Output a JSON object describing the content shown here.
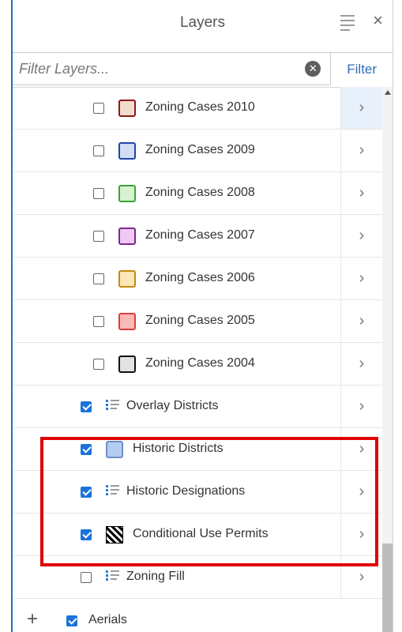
{
  "header": {
    "title": "Layers",
    "close_glyph": "×",
    "menu_icon": "list-menu-icon"
  },
  "filter": {
    "placeholder": "Filter Layers...",
    "value": "",
    "clear_glyph": "✕",
    "button_label": "Filter"
  },
  "layers": [
    {
      "label": "Zoning Cases 2010",
      "checked": false,
      "icon": "swatch",
      "fill": "#f4dccd",
      "stroke": "#8b1a1a",
      "indent": 102,
      "active": true
    },
    {
      "label": "Zoning Cases 2009",
      "checked": false,
      "icon": "swatch",
      "fill": "#d2def5",
      "stroke": "#2346a5",
      "indent": 102
    },
    {
      "label": "Zoning Cases 2008",
      "checked": false,
      "icon": "swatch",
      "fill": "#d8f2cf",
      "stroke": "#3aa43a",
      "indent": 102
    },
    {
      "label": "Zoning Cases 2007",
      "checked": false,
      "icon": "swatch",
      "fill": "#f0c9f2",
      "stroke": "#7a2a8d",
      "indent": 102
    },
    {
      "label": "Zoning Cases 2006",
      "checked": false,
      "icon": "swatch",
      "fill": "#fbe6b8",
      "stroke": "#c58a10",
      "indent": 102
    },
    {
      "label": "Zoning Cases 2005",
      "checked": false,
      "icon": "swatch",
      "fill": "#f9b9b9",
      "stroke": "#e03c3c",
      "indent": 102
    },
    {
      "label": "Zoning Cases 2004",
      "checked": false,
      "icon": "swatch",
      "fill": "#e2e2e2",
      "stroke": "#111111",
      "indent": 102
    },
    {
      "label": "Overlay Districts",
      "checked": true,
      "icon": "list",
      "indent": 86
    },
    {
      "label": "Historic Districts",
      "checked": true,
      "icon": "swatch",
      "fill": "#b3cdf0",
      "stroke": "#6c8fc6",
      "indent": 86
    },
    {
      "label": "Historic Designations",
      "checked": true,
      "icon": "list",
      "indent": 86
    },
    {
      "label": "Conditional Use Permits",
      "checked": true,
      "icon": "hatch",
      "indent": 86
    },
    {
      "label": "Zoning Fill",
      "checked": false,
      "icon": "list",
      "indent": 86
    }
  ],
  "bottom": {
    "plus_glyph": "+",
    "label": "Aerials",
    "checked": true
  },
  "chevron_glyph": "›",
  "colors": {
    "accent": "#1a73d8",
    "highlight": "#e00000",
    "filter_text": "#2f6cb3"
  }
}
